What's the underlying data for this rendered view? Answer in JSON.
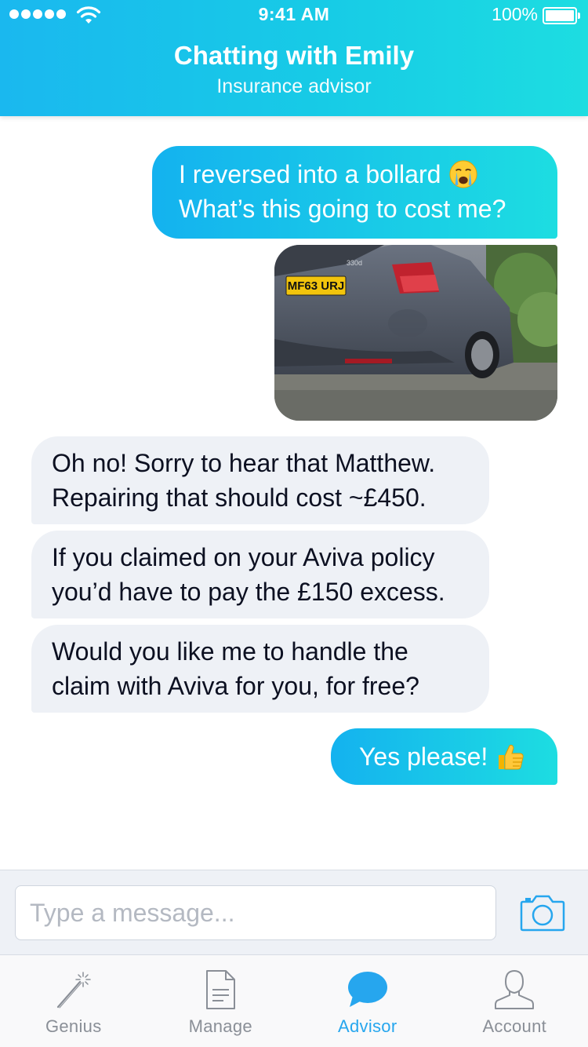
{
  "status_bar": {
    "time": "9:41 AM",
    "battery": "100%"
  },
  "header": {
    "title": "Chatting with Emily",
    "subtitle": "Insurance advisor"
  },
  "messages": {
    "m1_line1": "I reversed into a bollard",
    "m1_line2": "What’s this going to cost me?",
    "m2_line1": "Oh no! Sorry to hear that Matthew.",
    "m2_line2": "Repairing that should cost ~£450.",
    "m3_line1": "If you claimed on your Aviva policy",
    "m3_line2": "you’d have to pay the £150 excess.",
    "m4_line1": "Would you like me to handle the",
    "m4_line2": "claim with Aviva for you, for free?",
    "m5": "Yes please!",
    "photo_plate": "MF63 URJ",
    "photo_badge": "330d"
  },
  "composer": {
    "placeholder": "Type a message..."
  },
  "tabs": [
    {
      "label": "Genius",
      "icon": "magic-wand-icon"
    },
    {
      "label": "Manage",
      "icon": "document-icon"
    },
    {
      "label": "Advisor",
      "icon": "chat-bubble-icon"
    },
    {
      "label": "Account",
      "icon": "person-icon"
    }
  ],
  "colors": {
    "accent": "#26a6ee",
    "gradient_start": "#14b2ef",
    "gradient_end": "#1ddde1",
    "incoming_bubble": "#eef1f6"
  }
}
